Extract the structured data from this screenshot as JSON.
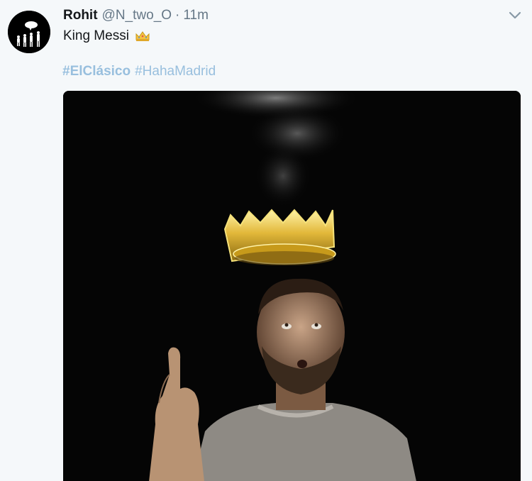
{
  "tweet": {
    "user": {
      "display_name": "Rohit",
      "handle": "@N_two_O",
      "separator": "·",
      "time": "11m"
    },
    "text": "King Messi",
    "text_emoji": "crown-icon",
    "hashtags": [
      "#ElClásico",
      "#HahaMadrid"
    ],
    "media": {
      "type": "image",
      "description_icon": "media-image"
    }
  },
  "colors": {
    "background": "#f5f8fa",
    "name": "#14171a",
    "meta": "#657786",
    "hashtag": "#98bfde",
    "media_bg": "#000000",
    "crown_gold": "#d8b23a"
  }
}
